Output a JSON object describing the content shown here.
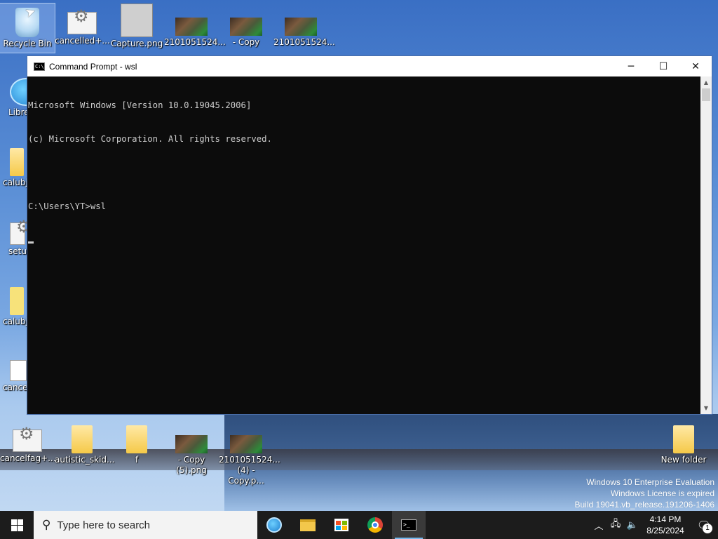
{
  "desktop": {
    "top_icons": [
      {
        "label": "Recycle Bin",
        "label2": ""
      },
      {
        "label": "cancelled+...",
        "label2": ""
      },
      {
        "label": "Capture.png",
        "label2": ""
      },
      {
        "label": "2101051524...",
        "label2": ""
      },
      {
        "label": "- Copy",
        "label2": ""
      },
      {
        "label": "2101051524...",
        "label2": ""
      }
    ],
    "left_icons": [
      {
        "label": "Libre"
      },
      {
        "label": "calubj"
      },
      {
        "label": "setup"
      },
      {
        "label": "calubj"
      },
      {
        "label": "cancel"
      }
    ],
    "bottom_icons": [
      {
        "label": "cancelfag+...",
        "label2": ""
      },
      {
        "label": "autistic_skid...",
        "label2": ""
      },
      {
        "label": "f",
        "label2": ""
      },
      {
        "label": "- Copy",
        "label2": "(5).png"
      },
      {
        "label": "2101051524...",
        "label2": "(4) - Copy.p..."
      }
    ],
    "right_icon": {
      "label": "New folder"
    }
  },
  "cmd_window": {
    "title": "Command Prompt - wsl",
    "app_icon_text": "C:\\",
    "controls": {
      "minimize": "─",
      "maximize": "☐",
      "close": "✕"
    },
    "lines": [
      "Microsoft Windows [Version 10.0.19045.2006]",
      "(c) Microsoft Corporation. All rights reserved.",
      "",
      "C:\\Users\\YT>wsl"
    ]
  },
  "watermark": {
    "line1": "Windows 10 Enterprise Evaluation",
    "line2": "Windows License is expired",
    "line3": "Build 19041.vb_release.191206-1406"
  },
  "taskbar": {
    "search_placeholder": "Type here to search",
    "apps": [
      "browser-icon",
      "file-explorer-icon",
      "store-icon",
      "chrome-icon",
      "command-prompt-icon"
    ],
    "clock": {
      "time": "4:14 PM",
      "date": "8/25/2024"
    },
    "notification_count": "1"
  }
}
